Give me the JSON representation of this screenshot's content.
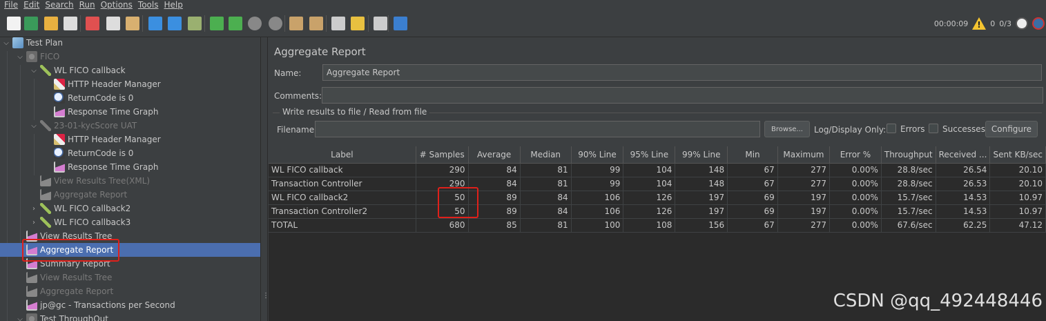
{
  "menu": [
    "File",
    "Edit",
    "Search",
    "Run",
    "Options",
    "Tools",
    "Help"
  ],
  "toolbar": {
    "timer": "00:00:09",
    "warnings": "0",
    "threads": "0/3",
    "icons": [
      "new-icon",
      "templates-icon",
      "open-icon",
      "save-icon",
      "cut-icon",
      "copy-icon",
      "paste-icon",
      "expand-icon",
      "collapse-icon",
      "toggle-icon",
      "start-icon",
      "start-no-pause-icon",
      "stop-icon",
      "shutdown-icon",
      "clear-icon",
      "clear-all-icon",
      "search-icon",
      "reset-search-icon",
      "function-helper-icon",
      "help-icon"
    ]
  },
  "tree": [
    {
      "label": "Test Plan",
      "icon": "flask-icon",
      "arrow": "⌵",
      "disabled": false
    },
    {
      "label": "FICO",
      "icon": "gear-icon",
      "arrow": "⌵",
      "disabled": true
    },
    {
      "label": "WL FICO callback",
      "icon": "pipette-icon",
      "arrow": "⌵",
      "disabled": false
    },
    {
      "label": "HTTP Header Manager",
      "icon": "tools-icon",
      "arrow": "",
      "disabled": false
    },
    {
      "label": "ReturnCode is 0",
      "icon": "lens-icon",
      "arrow": "",
      "disabled": false
    },
    {
      "label": "Response Time Graph",
      "icon": "graph-icon",
      "arrow": "",
      "disabled": false
    },
    {
      "label": "23-01-kycScore UAT",
      "icon": "pipette-icon",
      "arrow": "⌵",
      "disabled": true
    },
    {
      "label": "HTTP Header Manager",
      "icon": "tools-icon",
      "arrow": "",
      "disabled": false
    },
    {
      "label": "ReturnCode is 0",
      "icon": "lens-icon",
      "arrow": "",
      "disabled": false
    },
    {
      "label": "Response Time Graph",
      "icon": "graph-icon",
      "arrow": "",
      "disabled": false
    },
    {
      "label": "View Results Tree(XML)",
      "icon": "graph-icon",
      "arrow": "",
      "disabled": true
    },
    {
      "label": "Aggregate Report",
      "icon": "graph-icon",
      "arrow": "",
      "disabled": true
    },
    {
      "label": "WL FICO callback2",
      "icon": "pipette-icon",
      "arrow": "›",
      "disabled": false
    },
    {
      "label": "WL FICO callback3",
      "icon": "pipette-icon",
      "arrow": "›",
      "disabled": false
    },
    {
      "label": "View Results Tree",
      "icon": "graph-icon",
      "arrow": "",
      "disabled": false
    },
    {
      "label": "Aggregate Report",
      "icon": "graph-icon",
      "arrow": "",
      "disabled": false,
      "selected": true
    },
    {
      "label": "Summary Report",
      "icon": "graph-icon",
      "arrow": "",
      "disabled": false
    },
    {
      "label": "View Results Tree",
      "icon": "graph-icon",
      "arrow": "",
      "disabled": true
    },
    {
      "label": "Aggregate Report",
      "icon": "graph-icon",
      "arrow": "",
      "disabled": true
    },
    {
      "label": "jp@gc - Transactions per Second",
      "icon": "graph-icon",
      "arrow": "",
      "disabled": false
    },
    {
      "label": "Test ThroughOut",
      "icon": "gear-icon",
      "arrow": "⌵",
      "disabled": false
    }
  ],
  "panel": {
    "title": "Aggregate Report",
    "name_label": "Name:",
    "name_value": "Aggregate Report",
    "comments_label": "Comments:",
    "comments_value": "",
    "file_group_title": "Write results to file / Read from file",
    "filename_label": "Filename",
    "filename_value": "",
    "browse_label": "Browse...",
    "log_display_label": "Log/Display Only:",
    "errors_label": "Errors",
    "successes_label": "Successes",
    "configure_label": "Configure"
  },
  "table": {
    "columns": [
      "Label",
      "# Samples",
      "Average",
      "Median",
      "90% Line",
      "95% Line",
      "99% Line",
      "Min",
      "Maximum",
      "Error %",
      "Throughput",
      "Received ...",
      "Sent KB/sec"
    ],
    "rows": [
      [
        "WL FICO callback",
        "290",
        "84",
        "81",
        "99",
        "104",
        "148",
        "67",
        "277",
        "0.00%",
        "28.8/sec",
        "26.54",
        "20.10"
      ],
      [
        "Transaction Controller",
        "290",
        "84",
        "81",
        "99",
        "104",
        "148",
        "67",
        "277",
        "0.00%",
        "28.8/sec",
        "26.53",
        "20.10"
      ],
      [
        "WL FICO callback2",
        "50",
        "89",
        "84",
        "106",
        "126",
        "197",
        "69",
        "197",
        "0.00%",
        "15.7/sec",
        "14.53",
        "10.97"
      ],
      [
        "Transaction Controller2",
        "50",
        "89",
        "84",
        "106",
        "126",
        "197",
        "69",
        "197",
        "0.00%",
        "15.7/sec",
        "14.53",
        "10.97"
      ],
      [
        "TOTAL",
        "680",
        "85",
        "81",
        "100",
        "108",
        "156",
        "67",
        "277",
        "0.00%",
        "67.6/sec",
        "62.25",
        "47.12"
      ]
    ]
  },
  "watermark": "CSDN @qq_492448446",
  "colors": {
    "selection": "#4b6eaf",
    "highlight_box": "#e0201a",
    "background": "#3c3f41"
  }
}
